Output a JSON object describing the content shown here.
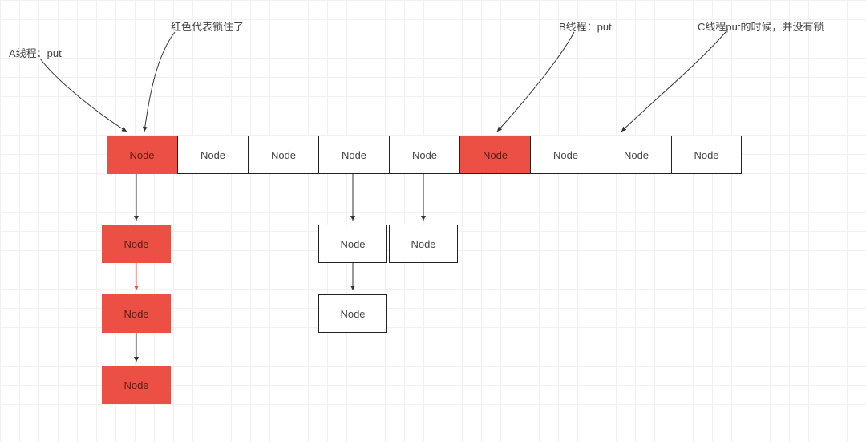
{
  "annotations": {
    "threadA": "A线程：put",
    "lockedMeaning": "红色代表锁住了",
    "threadB": "B线程：put",
    "threadC": "C线程put的时候，并没有锁"
  },
  "nodeText": {
    "node": "Node"
  },
  "topRow": {
    "cells": [
      {
        "label": "Node",
        "locked": true
      },
      {
        "label": "Node",
        "locked": false
      },
      {
        "label": "Node",
        "locked": false
      },
      {
        "label": "Node",
        "locked": false
      },
      {
        "label": "Node",
        "locked": false
      },
      {
        "label": "Node",
        "locked": true
      },
      {
        "label": "Node",
        "locked": false
      },
      {
        "label": "Node",
        "locked": false
      },
      {
        "label": "Node",
        "locked": false
      }
    ]
  },
  "chainA": {
    "nodes": [
      {
        "label": "Node",
        "locked": true
      },
      {
        "label": "Node",
        "locked": true
      },
      {
        "label": "Node",
        "locked": true
      }
    ]
  },
  "chainMiddle": {
    "pairLeft": {
      "label": "Node",
      "locked": false
    },
    "pairRight": {
      "label": "Node",
      "locked": false
    },
    "below": {
      "label": "Node",
      "locked": false
    }
  },
  "colors": {
    "locked": "#ec5044",
    "stroke": "#222222"
  }
}
